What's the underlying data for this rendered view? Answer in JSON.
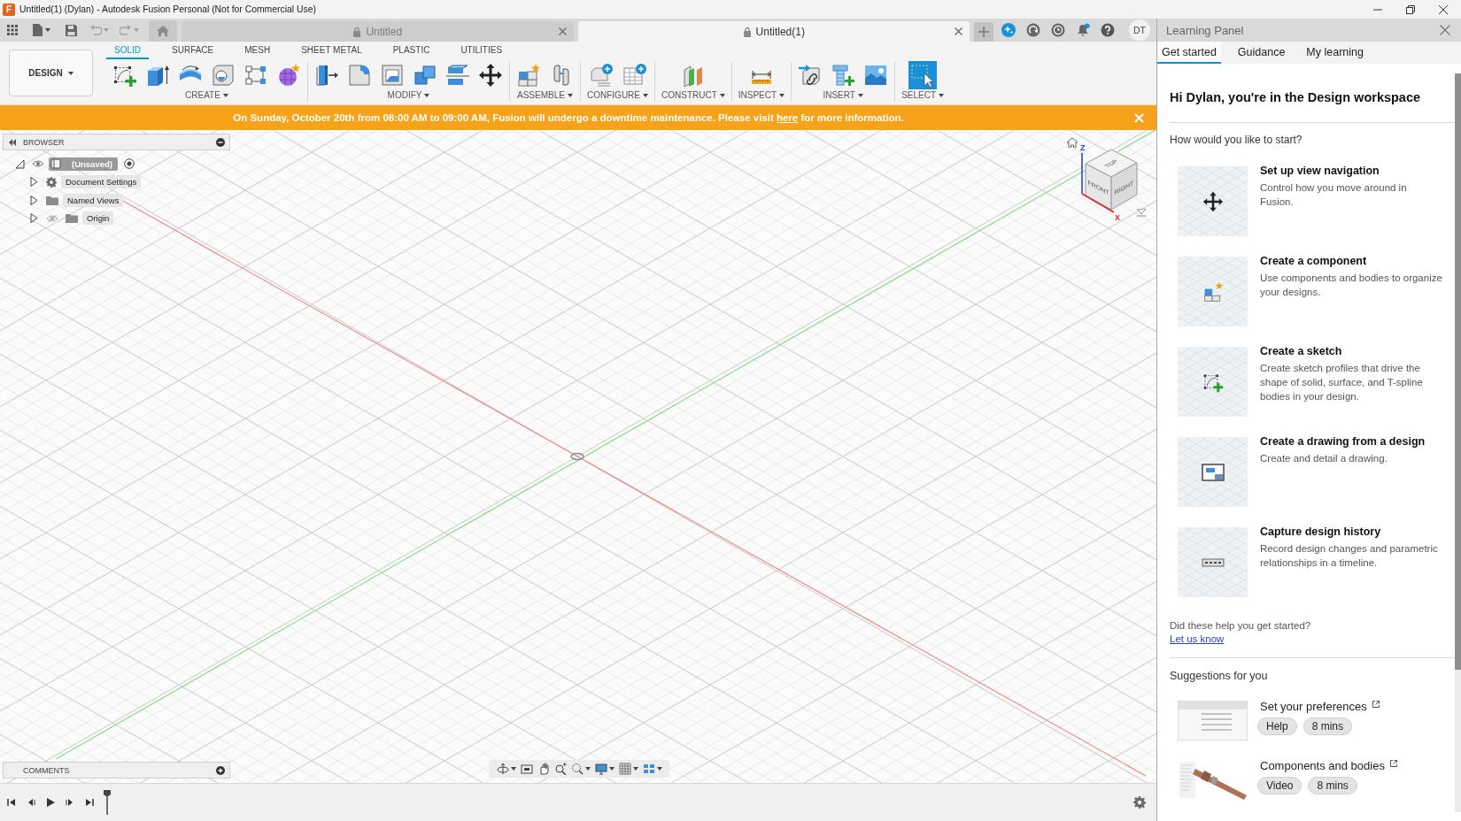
{
  "window": {
    "app_badge": "F",
    "title": "Untitled(1) (Dylan) - Autodesk Fusion Personal (Not for Commercial Use)"
  },
  "quick_access": {
    "undo": {
      "disabled": true
    },
    "redo": {
      "disabled": true
    }
  },
  "document_tabs": [
    {
      "label": "Untitled",
      "selected": false
    },
    {
      "label": "Untitled(1)",
      "selected": true
    }
  ],
  "notifications": {
    "unread": true
  },
  "account": {
    "initials": "DT"
  },
  "workspace": {
    "label": "DESIGN"
  },
  "toolbar_tabs": [
    {
      "label": "SOLID",
      "selected": true
    },
    {
      "label": "SURFACE",
      "selected": false
    },
    {
      "label": "MESH",
      "selected": false
    },
    {
      "label": "SHEET METAL",
      "selected": false
    },
    {
      "label": "PLASTIC",
      "selected": false
    },
    {
      "label": "UTILITIES",
      "selected": false
    }
  ],
  "tool_groups": [
    {
      "label": "CREATE"
    },
    {
      "label": "MODIFY"
    },
    {
      "label": "ASSEMBLE"
    },
    {
      "label": "CONFIGURE"
    },
    {
      "label": "CONSTRUCT"
    },
    {
      "label": "INSPECT"
    },
    {
      "label": "INSERT"
    },
    {
      "label": "SELECT"
    }
  ],
  "banner": {
    "text_before": "On Sunday, October 20th from 08:00 AM to 09:00 AM, Fusion will undergo a downtime maintenance. Please visit ",
    "link": "here",
    "text_after": " for more information."
  },
  "browser": {
    "title": "BROWSER",
    "root": {
      "label": "(Unsaved)",
      "expanded": true,
      "visible": true,
      "children": [
        {
          "label": "Document Settings",
          "kind": "settings",
          "expanded": false
        },
        {
          "label": "Named Views",
          "kind": "folder",
          "expanded": false
        },
        {
          "label": "Origin",
          "kind": "folder",
          "expanded": false,
          "visible": false
        }
      ]
    }
  },
  "view_cube": {
    "top": "TOP",
    "front": "FRONT",
    "right": "RIGHT",
    "z_axis": "Z",
    "x_axis": "X"
  },
  "comments": {
    "title": "COMMENTS"
  },
  "learning_panel": {
    "title": "Learning Panel",
    "tabs": [
      {
        "label": "Get started",
        "selected": true
      },
      {
        "label": "Guidance",
        "selected": false
      },
      {
        "label": "My learning",
        "selected": false
      }
    ],
    "heading": "Hi Dylan, you're in the Design workspace",
    "prompt": "How would you like to start?",
    "cards": [
      {
        "title": "Set up view navigation",
        "description": "Control how you move around in\nFusion."
      },
      {
        "title": "Create a component",
        "description": "Use components and bodies to organize\nyour designs."
      },
      {
        "title": "Create a sketch",
        "description": "Create sketch profiles that drive the\nshape of solid, surface, and T-spline\nbodies in your design."
      },
      {
        "title": "Create a drawing from a design",
        "description": "Create and detail a drawing."
      },
      {
        "title": "Capture design history",
        "description": "Record design changes and parametric\nrelationships in a timeline."
      }
    ],
    "feedback": {
      "question": "Did these help you get started?",
      "link": "Let us know"
    },
    "suggestions_title": "Suggestions for you",
    "suggestions": [
      {
        "title": "Set your preferences",
        "tags": [
          "Help",
          "8 mins"
        ]
      },
      {
        "title": "Components and bodies",
        "tags": [
          "Video",
          "8 mins"
        ]
      }
    ]
  }
}
